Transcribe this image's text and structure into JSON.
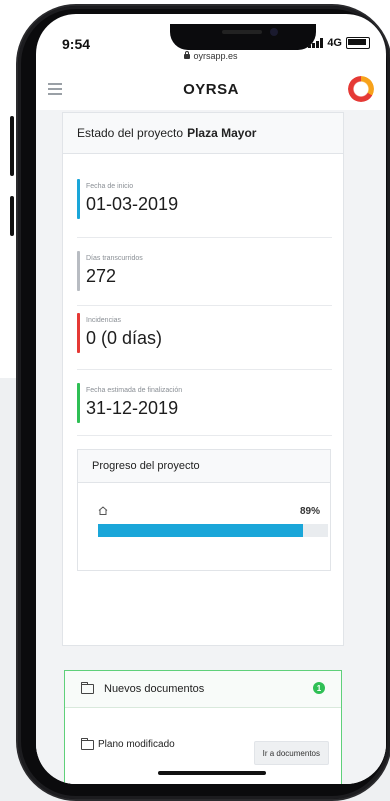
{
  "status_bar": {
    "time": "9:54",
    "network": "4G"
  },
  "browser": {
    "url": "oyrsapp.es"
  },
  "app": {
    "logo_text": "OYRSA",
    "accent_colors": [
      "#e53935",
      "#f7a21b"
    ]
  },
  "project": {
    "title_prefix": "Estado del proyecto",
    "title_name": "Plaza Mayor",
    "metrics": [
      {
        "label": "Fecha de inicio",
        "value": "01-03-2019",
        "color": "#1aa6d9"
      },
      {
        "label": "Días transcurridos",
        "value": "272",
        "color": "#b8bcc2"
      },
      {
        "label": "Incidencias",
        "value": "0 (0 días)",
        "color": "#e53935"
      },
      {
        "label": "Fecha estimada de finalización",
        "value": "31-12-2019",
        "color": "#2fbf55"
      }
    ],
    "progress": {
      "title": "Progreso del proyecto",
      "percent_label": "89%",
      "percent": 89
    }
  },
  "documents": {
    "title": "Nuevos documentos",
    "badge_count": "1",
    "items": [
      {
        "name": "Plano modificado",
        "action_label": "Ir a documentos"
      }
    ]
  }
}
